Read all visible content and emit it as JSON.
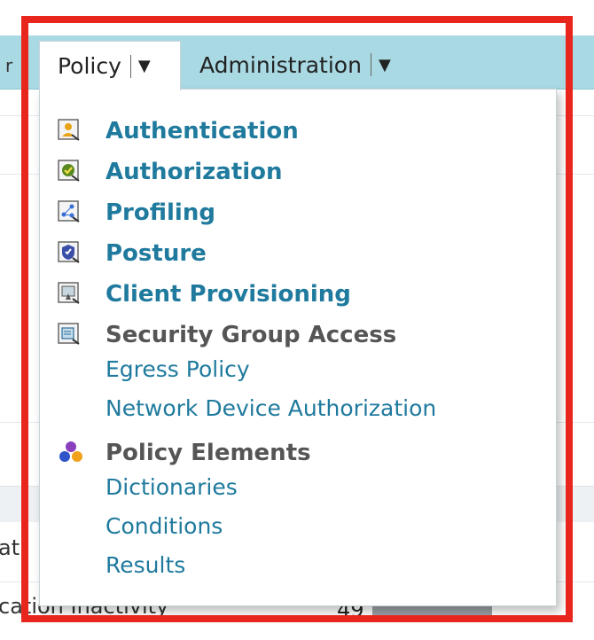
{
  "nav": {
    "tabs": [
      {
        "label": "Policy"
      },
      {
        "label": "Administration"
      }
    ],
    "caret_glyph": "▼"
  },
  "menu": {
    "items": [
      {
        "label": "Authentication",
        "icon": "authentication-icon"
      },
      {
        "label": "Authorization",
        "icon": "authorization-icon"
      },
      {
        "label": "Profiling",
        "icon": "profiling-icon"
      },
      {
        "label": "Posture",
        "icon": "posture-icon"
      },
      {
        "label": "Client Provisioning",
        "icon": "client-provisioning-icon"
      }
    ],
    "security_group_access": {
      "label": "Security Group Access",
      "icon": "security-group-access-icon",
      "children": [
        "Egress Policy",
        "Network Device Authorization"
      ]
    },
    "policy_elements": {
      "label": "Policy Elements",
      "icon": "policy-elements-icon",
      "children": [
        "Dictionaries",
        "Conditions",
        "Results"
      ]
    }
  },
  "background": {
    "row_partial_1": "ati",
    "row_partial_2": "cation Inactivity",
    "row_value": "49"
  },
  "colors": {
    "highlight": "#e8261d",
    "link": "#1f7a9e",
    "nav_bar": "#a9d9e3"
  }
}
